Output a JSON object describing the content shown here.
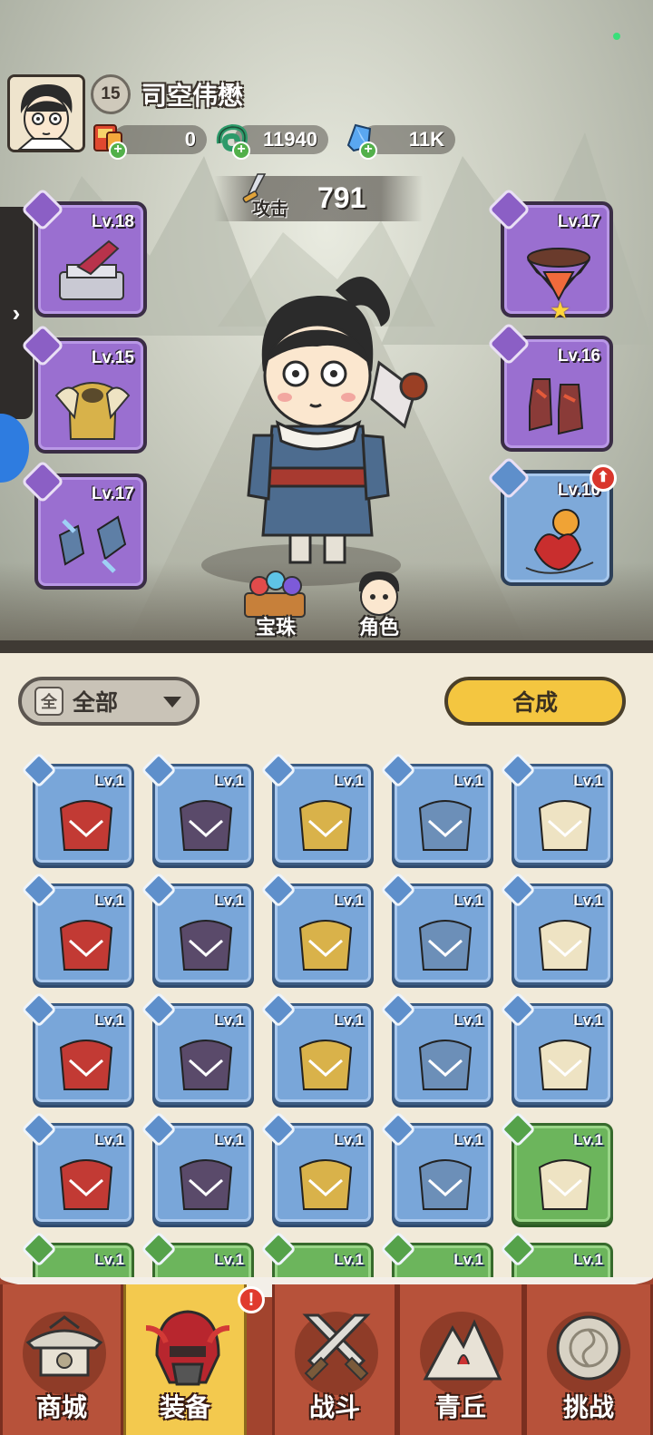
{
  "player": {
    "level": "15",
    "name": "司空伟懋"
  },
  "resources": [
    {
      "icon": "scroll-ticket-icon",
      "value": "0"
    },
    {
      "icon": "jade-dragon-icon",
      "value": "11940"
    },
    {
      "icon": "blue-crystal-icon",
      "value": "11K"
    }
  ],
  "attack": {
    "label": "攻击",
    "value": "791"
  },
  "equipped": {
    "left": [
      {
        "level": "Lv.18",
        "slot": "weapon"
      },
      {
        "level": "Lv.15",
        "slot": "armor"
      },
      {
        "level": "Lv.17",
        "slot": "bracer"
      }
    ],
    "right": [
      {
        "level": "Lv.17",
        "slot": "belt"
      },
      {
        "level": "Lv.16",
        "slot": "boots"
      },
      {
        "level": "Lv.10",
        "slot": "amulet"
      }
    ]
  },
  "buttons": {
    "orbs": "宝珠",
    "character": "角色",
    "filter": "全部",
    "filter_icon": "全",
    "combine": "合成"
  },
  "inventory": [
    {
      "level": "Lv.1",
      "slot": "bow",
      "rarity": "blue"
    },
    {
      "level": "Lv.1",
      "slot": "armor-red",
      "rarity": "blue"
    },
    {
      "level": "Lv.1",
      "slot": "armor-dark",
      "rarity": "blue"
    },
    {
      "level": "Lv.1",
      "slot": "armor-dark",
      "rarity": "blue"
    },
    {
      "level": "Lv.1",
      "slot": "armor-gold",
      "rarity": "blue"
    },
    {
      "level": "Lv.1",
      "slot": "bracer-red",
      "rarity": "blue"
    },
    {
      "level": "Lv.1",
      "slot": "bracer-blue",
      "rarity": "blue"
    },
    {
      "level": "Lv.1",
      "slot": "bracer-dark",
      "rarity": "blue"
    },
    {
      "level": "Lv.1",
      "slot": "bracer-dark",
      "rarity": "blue"
    },
    {
      "level": "Lv.1",
      "slot": "bracer-gold",
      "rarity": "blue"
    },
    {
      "level": "Lv.1",
      "slot": "belt-blue",
      "rarity": "blue"
    },
    {
      "level": "Lv.1",
      "slot": "belt-dark",
      "rarity": "blue"
    },
    {
      "level": "Lv.1",
      "slot": "belt-gold",
      "rarity": "blue"
    },
    {
      "level": "Lv.1",
      "slot": "boots-blue",
      "rarity": "blue"
    },
    {
      "level": "Lv.1",
      "slot": "boots-dark",
      "rarity": "blue"
    },
    {
      "level": "Lv.1",
      "slot": "boots-gold",
      "rarity": "blue"
    },
    {
      "level": "Lv.1",
      "slot": "amulet-red",
      "rarity": "blue"
    },
    {
      "level": "Lv.1",
      "slot": "amulet-blue",
      "rarity": "blue"
    },
    {
      "level": "Lv.1",
      "slot": "amulet-horn",
      "rarity": "blue"
    },
    {
      "level": "Lv.1",
      "slot": "weapon-flower",
      "rarity": "green"
    },
    {
      "level": "Lv.1",
      "slot": "weapon",
      "rarity": "green"
    },
    {
      "level": "Lv.1",
      "slot": "weapon",
      "rarity": "green"
    },
    {
      "level": "Lv.1",
      "slot": "weapon",
      "rarity": "green"
    },
    {
      "level": "Lv.1",
      "slot": "armor",
      "rarity": "green"
    },
    {
      "level": "Lv.1",
      "slot": "armor",
      "rarity": "green"
    }
  ],
  "nav": [
    {
      "label": "商城",
      "icon": "shop-pavilion-icon"
    },
    {
      "label": "装备",
      "icon": "helmet-icon",
      "active": true
    },
    {
      "label": "战斗",
      "icon": "crossed-swords-icon"
    },
    {
      "label": "青丘",
      "icon": "mountain-icon"
    },
    {
      "label": "挑战",
      "icon": "challenge-gong-icon"
    }
  ],
  "alerts": {
    "equip_tab": "!",
    "upgrade": "⬆"
  }
}
